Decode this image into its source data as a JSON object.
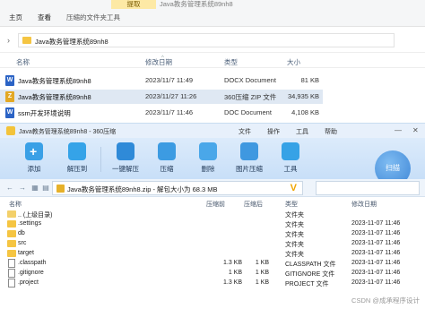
{
  "explorer": {
    "context_tab": "提取",
    "context_title": "Java教务管理系统89nh8",
    "tabs": [
      "主页",
      "查看",
      "压缩的文件夹工具"
    ],
    "address": "Java教务管理系统89nh8",
    "columns": [
      "名称",
      "修改日期",
      "类型",
      "大小"
    ],
    "rows": [
      {
        "name": "Java教务管理系统89nh8",
        "date": "2023/11/7 11:49",
        "type": "DOCX Document",
        "size": "81 KB",
        "icon": "word-icon",
        "selected": false
      },
      {
        "name": "Java教务管理系统89nh8",
        "date": "2023/11/27 11:26",
        "type": "360压缩 ZIP 文件",
        "size": "34,935 KB",
        "icon": "zip-icon",
        "selected": true
      },
      {
        "name": "ssm开发环境说明",
        "date": "2023/11/7 11:46",
        "type": "DOC Document",
        "size": "4,108 KB",
        "icon": "word-icon",
        "selected": false
      }
    ]
  },
  "zip": {
    "title": "Java教务管理系统89nh8 - 360压缩",
    "menu": [
      "文件",
      "操作",
      "工具",
      "帮助"
    ],
    "toolbar": {
      "add": "添加",
      "extract_to": "解压到",
      "one_click": "一键解压",
      "compress": "压缩",
      "delete": "删除",
      "image_tool": "图片压缩",
      "tools": "工具",
      "scan": "扫描"
    },
    "path": "Java教务管理系统89nh8.zip - 解包大小为 68.3 MB",
    "columns": [
      "名称",
      "压缩前",
      "压缩后",
      "类型",
      "修改日期"
    ],
    "rows": [
      {
        "name": ".. (上级目录)",
        "before": "",
        "after": "",
        "type": "文件夹",
        "date": "",
        "kind": "up"
      },
      {
        "name": ".settings",
        "before": "",
        "after": "",
        "type": "文件夹",
        "date": "2023-11-07 11:46",
        "kind": "folder"
      },
      {
        "name": "db",
        "before": "",
        "after": "",
        "type": "文件夹",
        "date": "2023-11-07 11:46",
        "kind": "folder"
      },
      {
        "name": "src",
        "before": "",
        "after": "",
        "type": "文件夹",
        "date": "2023-11-07 11:46",
        "kind": "folder"
      },
      {
        "name": "target",
        "before": "",
        "after": "",
        "type": "文件夹",
        "date": "2023-11-07 11:46",
        "kind": "folder"
      },
      {
        "name": ".classpath",
        "before": "1.3 KB",
        "after": "1 KB",
        "type": "CLASSPATH 文件",
        "date": "2023-11-07 11:46",
        "kind": "file"
      },
      {
        "name": ".gitignore",
        "before": "1 KB",
        "after": "1 KB",
        "type": "GITIGNORE 文件",
        "date": "2023-11-07 11:46",
        "kind": "file"
      },
      {
        "name": ".project",
        "before": "1.3 KB",
        "after": "1 KB",
        "type": "PROJECT 文件",
        "date": "2023-11-07 11:46",
        "kind": "file"
      }
    ],
    "watermark": "CSDN @成承程序设计"
  }
}
